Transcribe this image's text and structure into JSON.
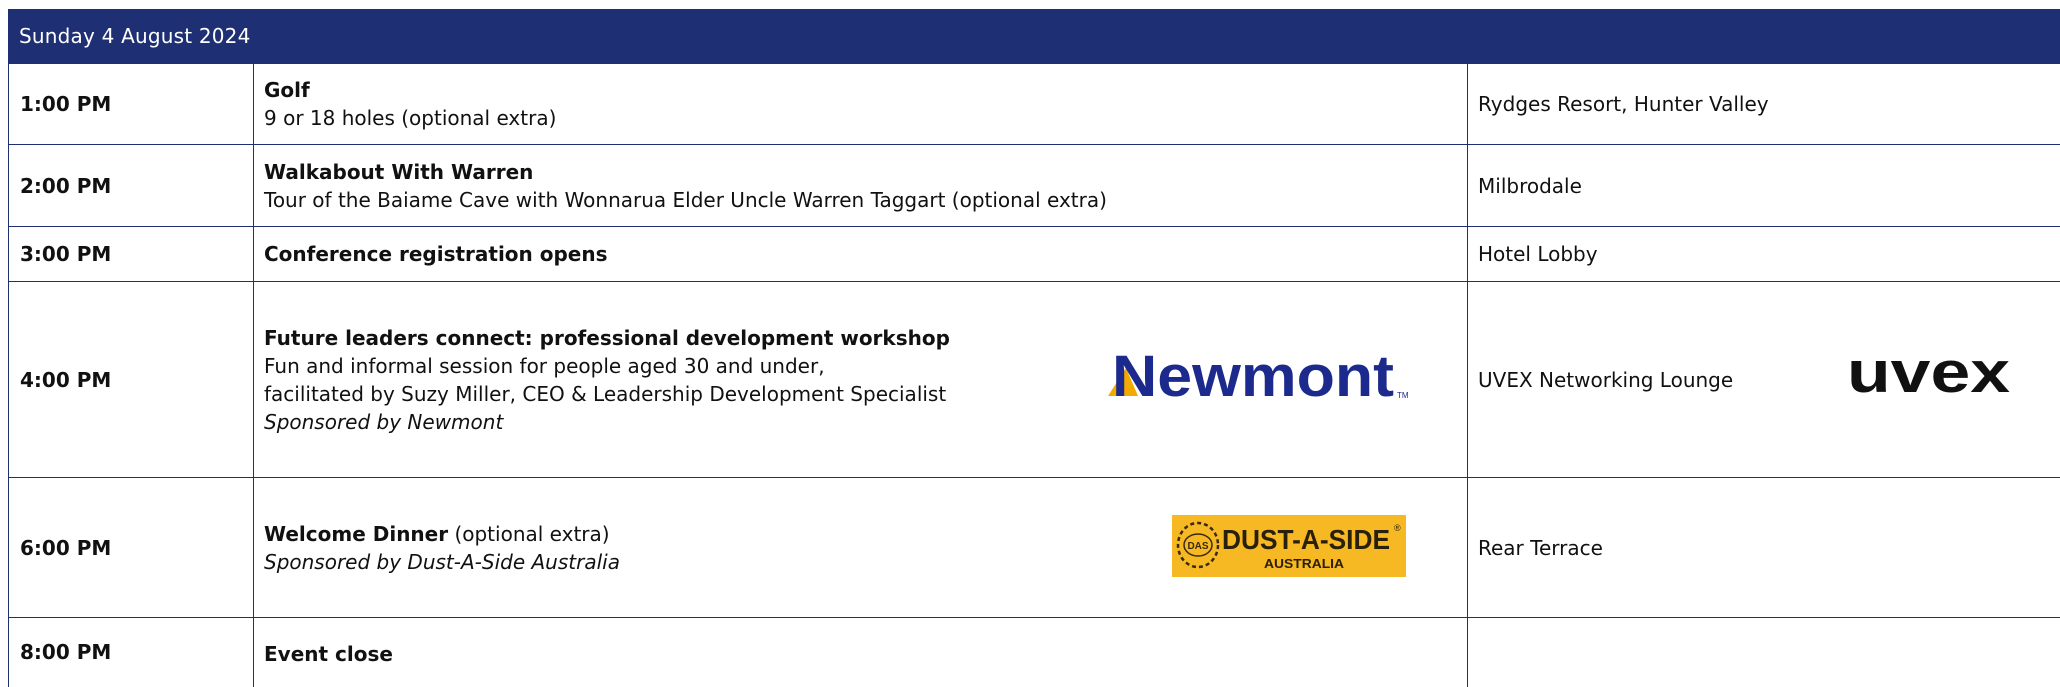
{
  "date_header": "Sunday 4 August 2024",
  "rows": [
    {
      "time": "1:00 PM",
      "title": "Golf",
      "lines": [
        "9 or 18 holes (optional extra)"
      ],
      "venue": "Rydges Resort, Hunter Valley"
    },
    {
      "time": "2:00 PM",
      "title": "Walkabout With Warren",
      "lines": [
        "Tour of the Baiame Cave with Wonnarua Elder Uncle Warren Taggart (optional extra)"
      ],
      "venue": "Milbrodale"
    },
    {
      "time": "3:00 PM",
      "title": "Conference registration opens",
      "venue": "Hotel Lobby"
    },
    {
      "time": "4:00 PM",
      "title": "Future leaders connect: professional development workshop",
      "lines": [
        "Fun and informal session for people aged 30 and under,",
        "facilitated by Suzy Miller, CEO & Leadership Development Specialist"
      ],
      "sponsor": "Sponsored by Newmont",
      "venue": "UVEX Networking Lounge"
    },
    {
      "time": "6:00 PM",
      "title": "Welcome Dinner",
      "title_suffix": " (optional extra)",
      "sponsor": "Sponsored by Dust-A-Side Australia",
      "venue": "Rear Terrace"
    },
    {
      "time": "8:00 PM",
      "title": "Event close",
      "venue": ""
    }
  ],
  "logos": {
    "newmont": {
      "text": "Newmont",
      "tm": "TM",
      "color": "#1b2a8c",
      "accent": "#f2a900"
    },
    "dust_a_side": {
      "text": "DUST-A-SIDE",
      "sub": "AUSTRALIA",
      "badge": "DAS",
      "reg": "®",
      "bg": "#f6b823"
    },
    "uvex": {
      "text": "uvex"
    }
  },
  "colors": {
    "header_bg": "#1f2f73",
    "grid": "#1f2f73"
  }
}
